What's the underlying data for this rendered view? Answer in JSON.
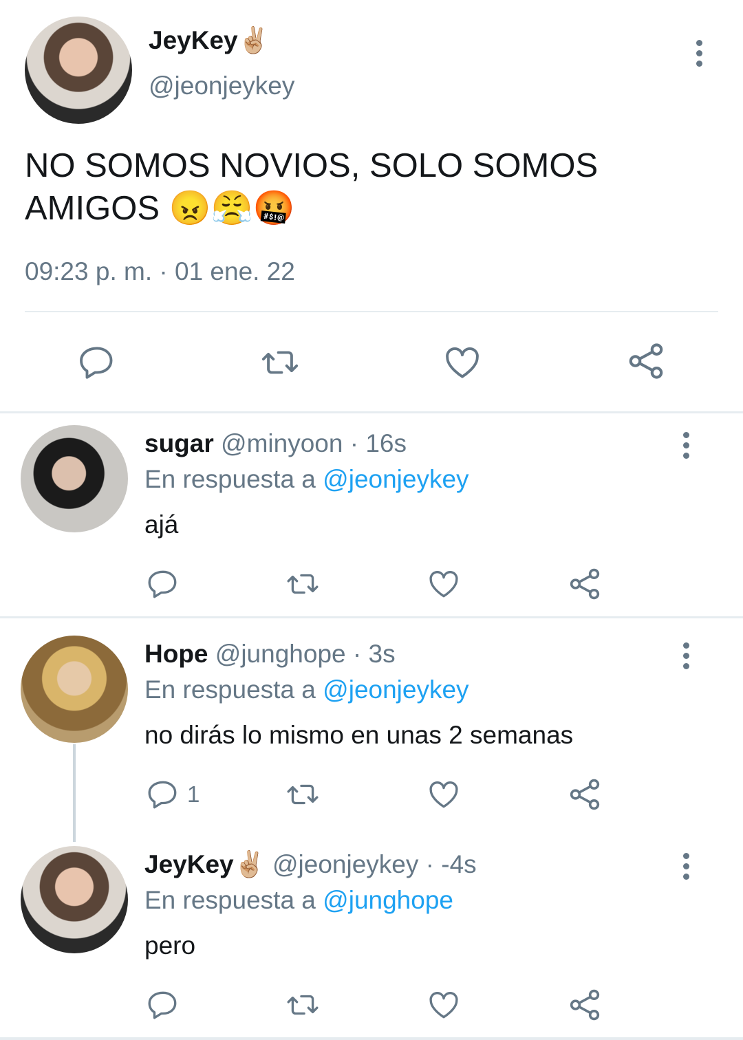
{
  "main_tweet": {
    "display_name": "JeyKey",
    "name_emoji": "✌🏼",
    "handle": "@jeonjeykey",
    "text_line1": "NO SOMOS NOVIOS, SOLO SOMOS",
    "text_line2": "AMIGOS",
    "emojis": [
      "😠",
      "😤",
      "🤬"
    ],
    "timestamp": "09:23 p. m. · 01 ene. 22"
  },
  "replies": [
    {
      "display_name": "sugar",
      "handle": "@minyoon",
      "time": "· 16s",
      "reply_prefix": "En respuesta a",
      "reply_to": "@jeonjeykey",
      "text": "ajá",
      "reply_count": ""
    },
    {
      "display_name": "Hope",
      "handle": "@junghope",
      "time": "· 3s",
      "reply_prefix": "En respuesta a",
      "reply_to": "@jeonjeykey",
      "text": "no dirás lo mismo en unas 2 semanas",
      "reply_count": "1"
    },
    {
      "display_name": "JeyKey",
      "name_emoji": "✌🏼",
      "handle": "@jeonjeykey",
      "time": "· -4s",
      "reply_prefix": "En respuesta a",
      "reply_to": "@junghope",
      "text": "pero",
      "reply_count": ""
    }
  ],
  "icons": {
    "reply": "reply-icon",
    "retweet": "retweet-icon",
    "like": "heart-icon",
    "share": "share-icon",
    "more": "more-vertical-icon"
  },
  "colors": {
    "link": "#1da1f2",
    "muted": "#657786",
    "text": "#14171a",
    "divider": "#e6ecf0"
  }
}
